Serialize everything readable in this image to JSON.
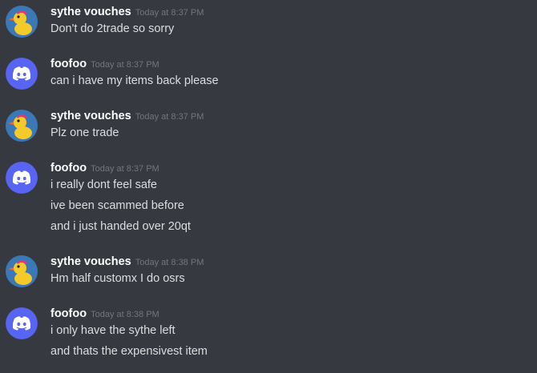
{
  "groups": [
    {
      "author": "sythe vouches",
      "avatar": "duck-avatar-icon",
      "timestamp": "Today at 8:37 PM",
      "lines": [
        "Don't do 2trade so sorry"
      ]
    },
    {
      "author": "foofoo",
      "avatar": "discord-logo-avatar-icon",
      "timestamp": "Today at 8:37 PM",
      "lines": [
        "can i have my items back please"
      ]
    },
    {
      "author": "sythe vouches",
      "avatar": "duck-avatar-icon",
      "timestamp": "Today at 8:37 PM",
      "lines": [
        "Plz one trade"
      ]
    },
    {
      "author": "foofoo",
      "avatar": "discord-logo-avatar-icon",
      "timestamp": "Today at 8:37 PM",
      "lines": [
        "i really dont feel safe",
        "ive been scammed before",
        "and i just handed over 20qt"
      ]
    },
    {
      "author": "sythe vouches",
      "avatar": "duck-avatar-icon",
      "timestamp": "Today at 8:38 PM",
      "lines": [
        "Hm half customx I do osrs"
      ]
    },
    {
      "author": "foofoo",
      "avatar": "discord-logo-avatar-icon",
      "timestamp": "Today at 8:38 PM",
      "lines": [
        "i only have the sythe left",
        "and thats the expensivest item"
      ]
    }
  ],
  "colors": {
    "background": "#36393f",
    "username": "#ffffff",
    "timestamp": "#72767d",
    "message": "#dcddde",
    "discord_blurple": "#5865f2",
    "duck_avatar_bg": "#3a78b8"
  }
}
